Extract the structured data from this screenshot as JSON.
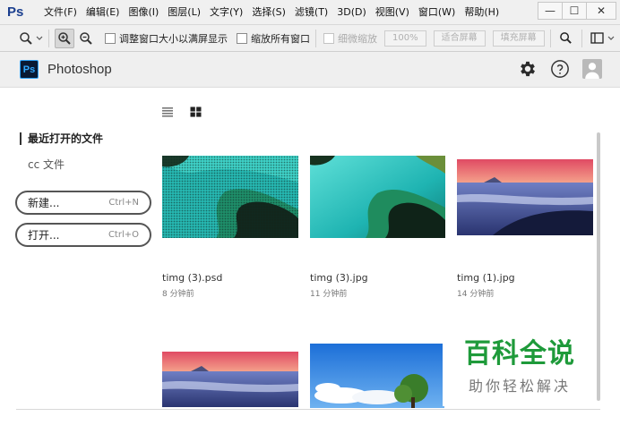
{
  "menubar": {
    "logo": "Ps",
    "items": [
      "文件(F)",
      "编辑(E)",
      "图像(I)",
      "图层(L)",
      "文字(Y)",
      "选择(S)",
      "滤镜(T)",
      "3D(D)",
      "视图(V)",
      "窗口(W)",
      "帮助(H)"
    ]
  },
  "window_buttons": {
    "minimize": "—",
    "restore": "☐",
    "close": "✕"
  },
  "options": {
    "check_resize": "调整窗口大小以满屏显示",
    "check_zoom_all": "缩放所有窗口",
    "check_scrubby": "细微缩放",
    "btn_100": "100%",
    "btn_fit": "适合屏幕",
    "btn_fill": "填充屏幕"
  },
  "home": {
    "app_name": "Photoshop",
    "badge": "Ps"
  },
  "sidebar": {
    "recent": "最近打开的文件",
    "cc_files": "cc 文件",
    "new_label": "新建...",
    "new_shortcut": "Ctrl+N",
    "open_label": "打开...",
    "open_shortcut": "Ctrl+O"
  },
  "files": [
    {
      "name": "timg (3).psd",
      "time": "8 分钟前"
    },
    {
      "name": "timg (3).jpg",
      "time": "11 分钟前"
    },
    {
      "name": "timg (1).jpg",
      "time": "14 分钟前"
    }
  ],
  "watermark": {
    "title": "百科全说",
    "subtitle": "助你轻松解决"
  },
  "colors": {
    "watermark_green": "#1e9a3a",
    "ps_blue": "#31a8ff",
    "ps_dark": "#0a1a33"
  }
}
